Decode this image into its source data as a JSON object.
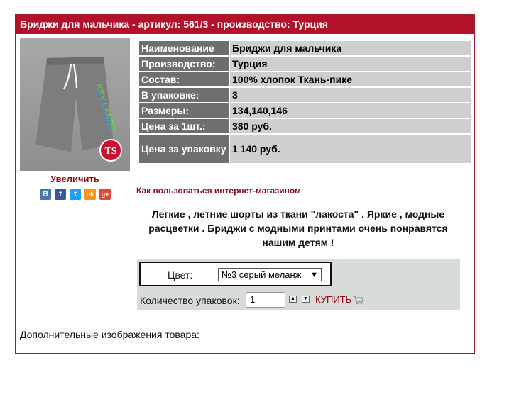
{
  "title": "Бриджи для мальчика - артикул: 561/3 - производство: Турция",
  "image": {
    "brand_text": "KEY LANDS",
    "badge": "TS"
  },
  "zoom_label": "Увеличить",
  "share": [
    {
      "icon": "vk-icon",
      "glyph": "B",
      "color": "#4a76a8"
    },
    {
      "icon": "facebook-icon",
      "glyph": "f",
      "color": "#3b5998"
    },
    {
      "icon": "twitter-icon",
      "glyph": "t",
      "color": "#1da1f2"
    },
    {
      "icon": "odnoklassniki-icon",
      "glyph": "ok",
      "color": "#f7931e"
    },
    {
      "icon": "google-plus-icon",
      "glyph": "g+",
      "color": "#dd4b39"
    }
  ],
  "specs": [
    {
      "key": "Наименование",
      "value": "Бриджи для мальчика"
    },
    {
      "key": "Производство:",
      "value": "Турция"
    },
    {
      "key": "Состав:",
      "value": "100% хлопок Ткань-пике"
    },
    {
      "key": "В упаковке:",
      "value": "3"
    },
    {
      "key": "Размеры:",
      "value": "134,140,146"
    },
    {
      "key": "Цена за 1шт.:",
      "value": "380 руб."
    },
    {
      "key": "Цена за упаковку",
      "value": "1 140 руб."
    }
  ],
  "howto_link": "Как пользоваться интернет-магазином",
  "description": "Легкие , летние шорты из ткани \"лакоста\" . Яркие , модные расцветки . Бриджи с модными принтами очень понравятся нашим детям !",
  "order": {
    "color_label": "Цвет:",
    "color_selected": "№3 серый меланж",
    "qty_label": "Количество упаковок:",
    "qty_value": "1",
    "buy_label": "КУПИТЬ"
  },
  "more_images_label": "Дополнительные изображения товара:",
  "colors": {
    "header": "#b3112a",
    "accent_text": "#8a0c1a",
    "spec_key_bg": "#6f6f6f",
    "spec_val_bg": "#cfcfcf",
    "order_bg": "#d7dcd8"
  }
}
